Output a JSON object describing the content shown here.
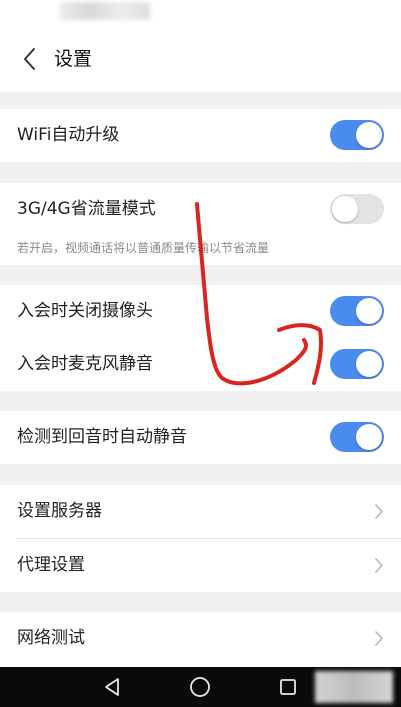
{
  "header": {
    "title": "设置"
  },
  "settings": {
    "wifi_upgrade": {
      "label": "WiFi自动升级",
      "enabled": true
    },
    "data_saver": {
      "label": "3G/4G省流量模式",
      "enabled": false,
      "hint": "若开启，视频通话将以普通质量传输以节省流量"
    },
    "camera_off_on_join": {
      "label": "入会时关闭摄像头",
      "enabled": true
    },
    "mic_mute_on_join": {
      "label": "入会时麦克风静音",
      "enabled": true
    },
    "echo_auto_mute": {
      "label": "检测到回音时自动静音",
      "enabled": true
    },
    "server_settings": {
      "label": "设置服务器"
    },
    "proxy_settings": {
      "label": "代理设置"
    },
    "network_test": {
      "label": "网络测试"
    }
  },
  "colors": {
    "toggle_on": "#4a8bef",
    "toggle_off": "#e3e3e3",
    "annotation": "#d8251f"
  },
  "icons": {
    "back": "chevron-left-icon",
    "row": "chevron-right-icon",
    "nav": [
      "back-triangle-icon",
      "home-circle-icon",
      "recents-square-icon"
    ]
  }
}
